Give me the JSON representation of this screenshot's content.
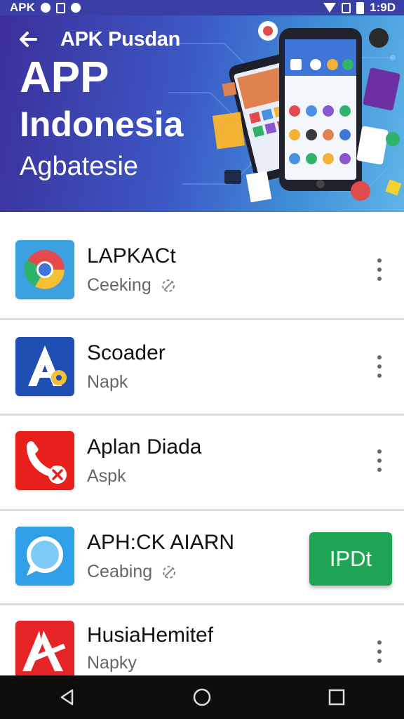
{
  "status_bar": {
    "left_text": "APK",
    "time": "1:9D"
  },
  "hero": {
    "subtitle": "APK Pusdan",
    "title_line1": "APP",
    "title_line2": "Indonesia",
    "caption": "Agbatesie"
  },
  "apps": [
    {
      "name": "LAPKACt",
      "subtitle": "Ceeking",
      "icon": "browser-icon",
      "has_badge_icon": true
    },
    {
      "name": "Scoader",
      "subtitle": "Napk",
      "icon": "app-store-icon",
      "has_badge_icon": false
    },
    {
      "name": "Aplan Diada",
      "subtitle": "Aspk",
      "icon": "phone-blocked-icon",
      "has_badge_icon": false
    },
    {
      "name": "APH:CK AIARN",
      "subtitle": "Ceabing",
      "icon": "chat-bubble-icon",
      "has_badge_icon": true
    },
    {
      "name": "HusiaHemitef",
      "subtitle": "Napky",
      "icon": "a-logo-icon",
      "has_badge_icon": false
    }
  ],
  "update_button": {
    "label": "IPDt"
  },
  "colors": {
    "status_bar": "#3a3fa6",
    "hero_start": "#3b2f9a",
    "hero_end": "#5fb5e6",
    "accent_green": "#1ea453",
    "nav_bar": "#0d0d0d"
  }
}
